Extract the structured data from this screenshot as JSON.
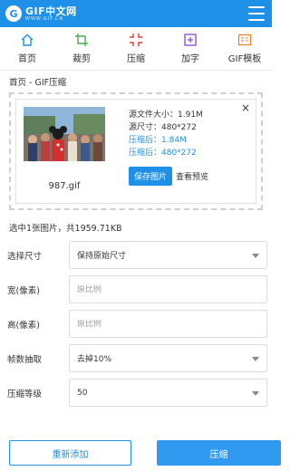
{
  "header": {
    "logo_title": "GIF中文网",
    "logo_sub": "WWW.GIF.CN"
  },
  "nav": [
    {
      "label": "首页",
      "icon": "home-icon"
    },
    {
      "label": "裁剪",
      "icon": "crop-icon"
    },
    {
      "label": "压缩",
      "icon": "compress-icon"
    },
    {
      "label": "加字",
      "icon": "add-text-icon"
    },
    {
      "label": "GIF模板",
      "icon": "gif-template-icon"
    }
  ],
  "breadcrumb": "首页 - GIF压缩",
  "preview": {
    "filename": "987.gif",
    "original_size": "源文件大小：1.91M",
    "original_dim": "源尺寸：480*272",
    "compressed_size": "压缩后：1.84M",
    "compressed_dim": "压缩后：480*272",
    "save_label": "保存图片",
    "preview_label": "查看预览",
    "close_glyph": "×"
  },
  "summary": "选中1张图片，共1959.71KB",
  "form": {
    "size_label": "选择尺寸",
    "size_value": "保持原始尺寸",
    "width_label": "宽(像素)",
    "width_placeholder": "原比例",
    "height_label": "高(像素)",
    "height_placeholder": "原比例",
    "frames_label": "帧数抽取",
    "frames_value": "去掉10%",
    "level_label": "压缩等级",
    "level_value": "50"
  },
  "buttons": {
    "reset": "重新添加",
    "compress": "压缩"
  },
  "colors": {
    "accent": "#1e90e8",
    "nav_icon_home": "#1e90e8",
    "nav_icon_crop": "#4caf50",
    "nav_icon_compress": "#e53935",
    "nav_icon_text": "#7b4fc9",
    "nav_icon_template": "#f08030"
  }
}
